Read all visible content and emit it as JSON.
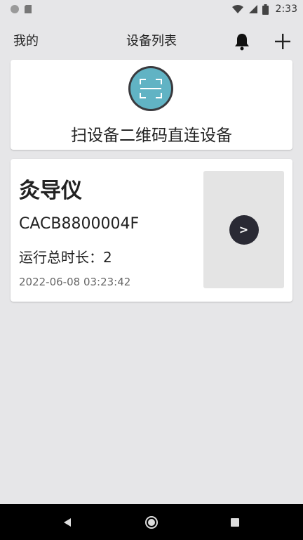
{
  "status_bar": {
    "time": "2:33"
  },
  "header": {
    "left_label": "我的",
    "title": "设备列表",
    "icons": {
      "notification": "bell-icon",
      "add": "plus-icon"
    }
  },
  "scan_card": {
    "label": "扫设备二维码直连设备",
    "icon": "qr-scan-icon",
    "accent_color": "#61b3c4"
  },
  "device": {
    "name": "灸导仪",
    "id": "CACB8800004F",
    "runtime": "运行总时长：2",
    "timestamp": "2022-06-08 03:23:42",
    "go_label": ">"
  }
}
